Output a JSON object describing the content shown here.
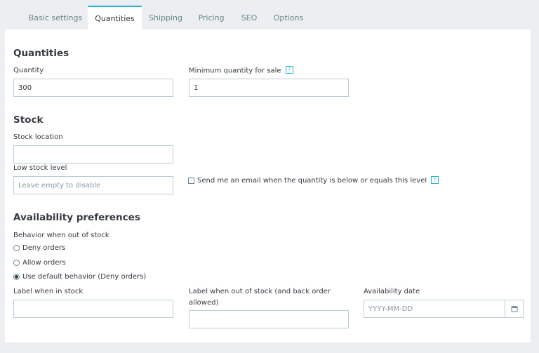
{
  "tabs": [
    {
      "label": "Basic settings"
    },
    {
      "label": "Quantities"
    },
    {
      "label": "Shipping"
    },
    {
      "label": "Pricing"
    },
    {
      "label": "SEO"
    },
    {
      "label": "Options"
    }
  ],
  "quantities": {
    "title": "Quantities",
    "quantity_label": "Quantity",
    "quantity_value": "300",
    "min_qty_label": "Minimum quantity for sale",
    "min_qty_value": "1"
  },
  "help_badge": "?",
  "stock": {
    "title": "Stock",
    "location_label": "Stock location",
    "location_value": "",
    "low_stock_label": "Low stock level",
    "low_stock_placeholder": "Leave empty to disable",
    "email_checkbox_label": "Send me an email when the quantity is below or equals this level",
    "email_checkbox_checked": false
  },
  "availability": {
    "title": "Availability preferences",
    "behavior_label": "Behavior when out of stock",
    "options": [
      {
        "label": "Deny orders",
        "checked": false
      },
      {
        "label": "Allow orders",
        "checked": false
      },
      {
        "label": "Use default behavior (Deny orders)",
        "checked": true
      }
    ],
    "in_stock_label": "Label when in stock",
    "in_stock_value": "",
    "out_stock_label": "Label when out of stock (and back order allowed)",
    "out_stock_value": "",
    "date_label": "Availability date",
    "date_placeholder": "YYYY-MM-DD",
    "date_icon": "calendar-icon"
  },
  "colors": {
    "accent": "#25b9d7",
    "background": "#eceef1",
    "border": "#bbcdd2",
    "text": "#363a41",
    "tab_text": "#6c868e"
  }
}
